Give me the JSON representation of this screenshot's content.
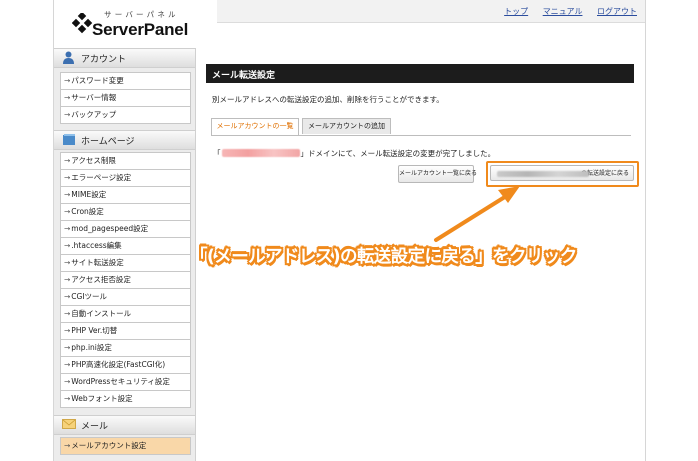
{
  "logo": {
    "kana": "サーバーパネル",
    "name": "ServerPanel"
  },
  "toplinks": [
    "トップ",
    "マニュアル",
    "ログアウト"
  ],
  "sidebar": {
    "account": {
      "title": "アカウント",
      "items": [
        "パスワード変更",
        "サーバー情報",
        "バックアップ"
      ]
    },
    "homepage": {
      "title": "ホームページ",
      "items": [
        "アクセス制限",
        "エラーページ設定",
        "MIME設定",
        "Cron設定",
        "mod_pagespeed設定",
        ".htaccess編集",
        "サイト転送設定",
        "アクセス拒否設定",
        "CGIツール",
        "自動インストール",
        "PHP Ver.切替",
        "php.ini設定",
        "PHP高速化設定(FastCGI化)",
        "WordPressセキュリティ設定",
        "Webフォント設定"
      ]
    },
    "mail": {
      "title": "メール",
      "items": [
        "メールアカウント設定"
      ]
    },
    "arrow_glyph": "→"
  },
  "main": {
    "title": "メール転送設定",
    "description": "別メールアドレスへの転送設定の追加、削除を行うことができます。",
    "tabs": [
      "メールアカウントの一覧",
      "メールアカウントの追加"
    ],
    "message_prefix": "「",
    "message_suffix": "」ドメインにて、メール転送設定の変更が完了しました。",
    "button_list": "メールアカウント一覧に戻る",
    "button_back": "の転送設定に戻る"
  },
  "annotation": "「(メールアドレス)の転送設定に戻る」をクリック",
  "colors": {
    "accent": "#f08a1c",
    "title_bar": "#1c1c1c",
    "active_menu": "#f9d7a8",
    "link": "#2b4d9e"
  }
}
